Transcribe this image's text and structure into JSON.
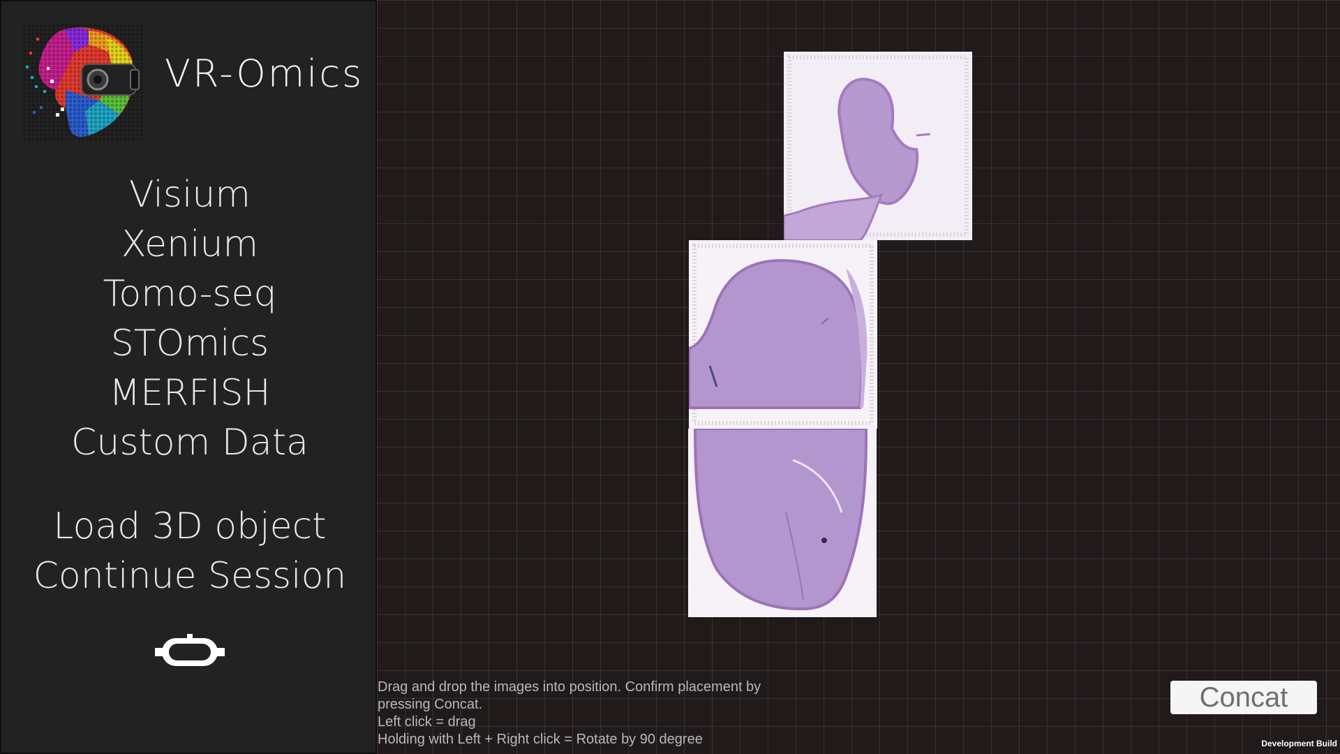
{
  "app": {
    "title": "VR-Omics"
  },
  "sidebar": {
    "data_types": [
      {
        "label": "Visium"
      },
      {
        "label": "Xenium"
      },
      {
        "label": "Tomo-seq"
      },
      {
        "label": "STOmics"
      },
      {
        "label": "MERFISH"
      },
      {
        "label": "Custom Data"
      }
    ],
    "actions": [
      {
        "label": "Load 3D object"
      },
      {
        "label": "Continue Session"
      }
    ],
    "vr_icon": "vr-headset-icon"
  },
  "workspace": {
    "instructions": [
      "Drag and drop the images into position. Confirm placement by",
      "pressing Concat.",
      "Left click = drag",
      "Holding with Left + Right click  = Rotate by 90 degree"
    ],
    "concat_label": "Concat",
    "images": [
      "tissue-section-1",
      "tissue-section-2",
      "tissue-section-3"
    ]
  },
  "footer": {
    "build_label": "Development Build"
  },
  "colors": {
    "sidebar_bg": "#222222",
    "workspace_bg": "#201a1b",
    "tissue": "#b69bd0",
    "tissue_edge": "#9e73b8"
  }
}
